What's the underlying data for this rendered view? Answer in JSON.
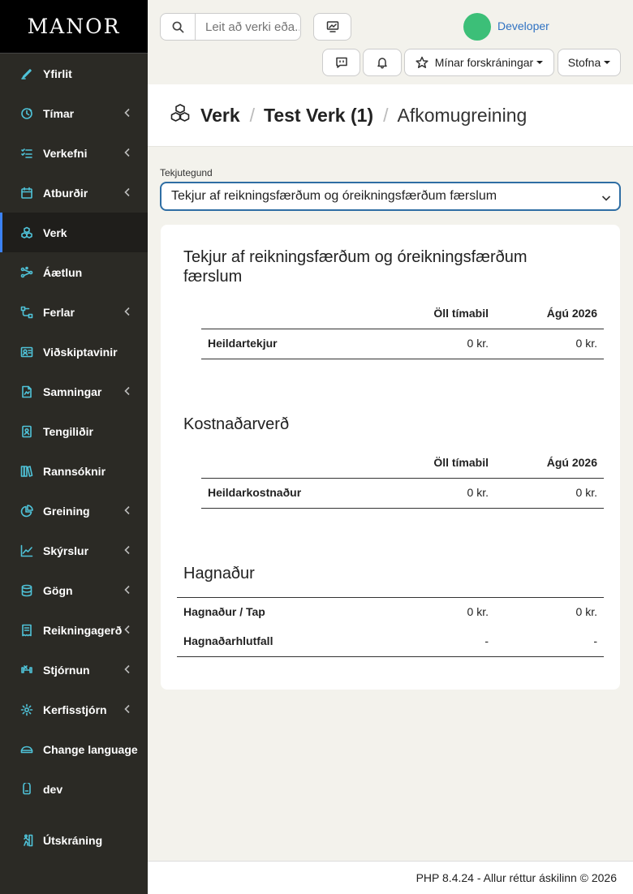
{
  "brand": "MANOR",
  "sidebar": {
    "items": [
      {
        "label": "Yfirlit",
        "icon": "pen-icon",
        "chevron": false
      },
      {
        "label": "Tímar",
        "icon": "clock-icon",
        "chevron": true
      },
      {
        "label": "Verkefni",
        "icon": "checklist-icon",
        "chevron": true
      },
      {
        "label": "Atburðir",
        "icon": "calendar-icon",
        "chevron": true
      },
      {
        "label": "Verk",
        "icon": "cubes-icon",
        "chevron": false,
        "active": true
      },
      {
        "label": "Áætlun",
        "icon": "network-icon",
        "chevron": false
      },
      {
        "label": "Ferlar",
        "icon": "flow-icon",
        "chevron": true
      },
      {
        "label": "Viðskiptavinir",
        "icon": "contact-card-icon",
        "chevron": false
      },
      {
        "label": "Samningar",
        "icon": "document-icon",
        "chevron": true
      },
      {
        "label": "Tengiliðir",
        "icon": "contact-book-icon",
        "chevron": false
      },
      {
        "label": "Rannsóknir",
        "icon": "books-icon",
        "chevron": false
      },
      {
        "label": "Greining",
        "icon": "pie-chart-icon",
        "chevron": true
      },
      {
        "label": "Skýrslur",
        "icon": "line-chart-icon",
        "chevron": true
      },
      {
        "label": "Gögn",
        "icon": "database-icon",
        "chevron": true
      },
      {
        "label": "Reikningagerð",
        "icon": "invoice-icon",
        "chevron": true
      },
      {
        "label": "Stjórnun",
        "icon": "dumbbell-icon",
        "chevron": true
      },
      {
        "label": "Kerfisstjórn",
        "icon": "gear-icon",
        "chevron": true
      },
      {
        "label": "Change language",
        "icon": "language-icon",
        "chevron": false
      },
      {
        "label": "dev",
        "icon": "user-icon",
        "chevron": false
      },
      {
        "label": "Útskráning",
        "icon": "logout-icon",
        "chevron": false
      }
    ]
  },
  "topbar": {
    "search_placeholder": "Leit að verki eða...",
    "user_name": "Developer",
    "favorites_label": "Mínar forskráningar",
    "create_label": "Stofna"
  },
  "header": {
    "crumb1": "Verk",
    "crumb2": "Test Verk (1)",
    "crumb3": "Afkomugreining"
  },
  "filter": {
    "label": "Tekjutegund",
    "value": "Tekjur af reikningsfærðum og óreikningsfærðum færslum"
  },
  "revenue": {
    "title": "Tekjur af reikningsfærðum og óreikningsfærðum færslum",
    "col1": "Öll tímabil",
    "col2": "Ágú 2026",
    "row_label": "Heildartekjur",
    "row_v1": "0 kr.",
    "row_v2": "0 kr."
  },
  "cost": {
    "title": "Kostnaðarverð",
    "col1": "Öll tímabil",
    "col2": "Ágú 2026",
    "row_label": "Heildarkostnaður",
    "row_v1": "0 kr.",
    "row_v2": "0 kr."
  },
  "profit": {
    "title": "Hagnaður",
    "row1_label": "Hagnaður / Tap",
    "row1_v1": "0 kr.",
    "row1_v2": "0 kr.",
    "row2_label": "Hagnaðarhlutfall",
    "row2_v1": "-",
    "row2_v2": "-"
  },
  "footer": "PHP 8.4.24 - Allur réttur áskilinn © 2026",
  "colors": {
    "accent": "#3b82f6",
    "icon": "#4fc3d9",
    "avatar": "#3cbf78",
    "link": "#2f72c2"
  }
}
